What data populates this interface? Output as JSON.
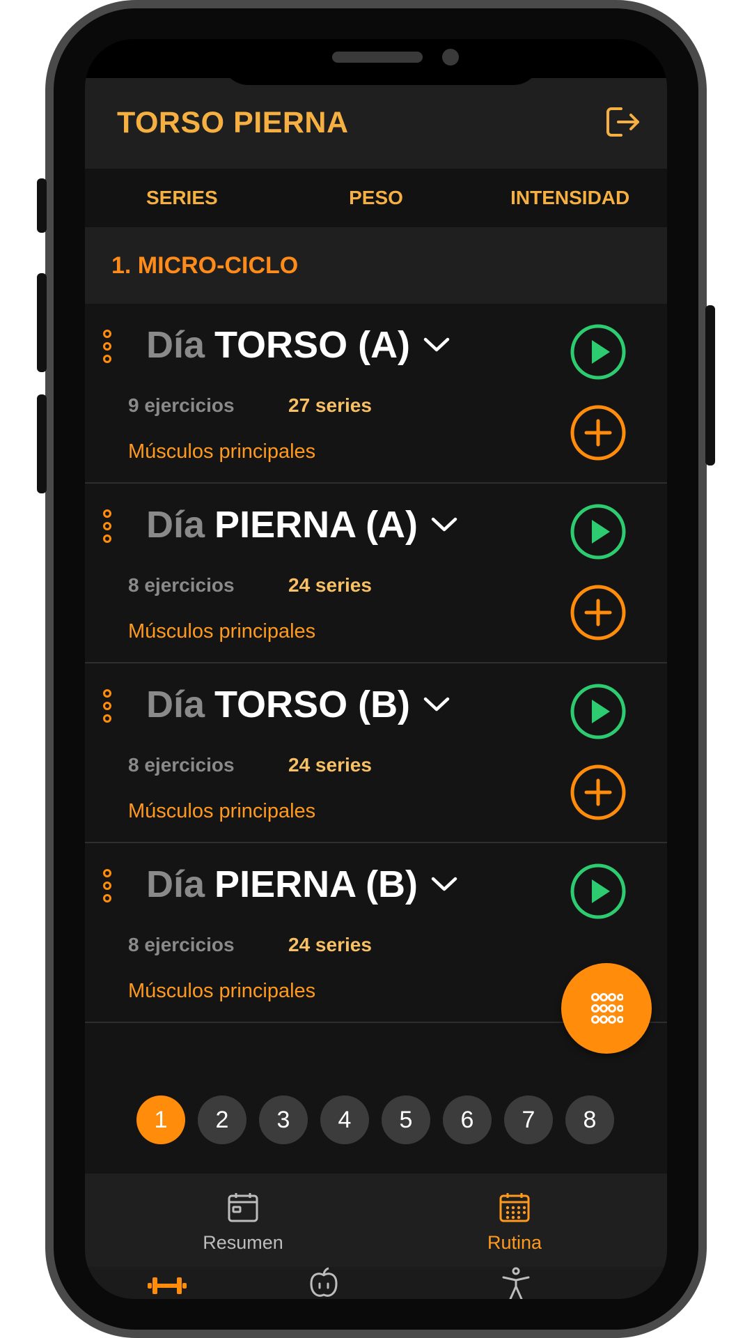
{
  "header": {
    "title": "TORSO PIERNA",
    "logout_icon": "logout-icon"
  },
  "tabs": [
    {
      "label": "SERIES"
    },
    {
      "label": "PESO"
    },
    {
      "label": "INTENSIDAD"
    }
  ],
  "cycle": {
    "title": "1. MICRO-CICLO"
  },
  "days": [
    {
      "prefix": "Día",
      "name": "TORSO (A)",
      "exercises": "9 ejercicios",
      "series": "27 series",
      "muscles": "Músculos principales"
    },
    {
      "prefix": "Día",
      "name": "PIERNA (A)",
      "exercises": "8 ejercicios",
      "series": "24 series",
      "muscles": "Músculos principales"
    },
    {
      "prefix": "Día",
      "name": "TORSO (B)",
      "exercises": "8 ejercicios",
      "series": "24 series",
      "muscles": "Músculos principales"
    },
    {
      "prefix": "Día",
      "name": "PIERNA (B)",
      "exercises": "8 ejercicios",
      "series": "24 series",
      "muscles": "Músculos principales"
    }
  ],
  "pager": {
    "pages": [
      "1",
      "2",
      "3",
      "4",
      "5",
      "6",
      "7",
      "8"
    ],
    "active": "1"
  },
  "subnav": {
    "items": [
      {
        "label": "Resumen",
        "icon": "calendar-icon",
        "active": false
      },
      {
        "label": "Rutina",
        "icon": "calendar-grid-icon",
        "active": true
      }
    ]
  },
  "bottomnav": {
    "items": [
      {
        "icon": "dumbbell-icon",
        "active": true
      },
      {
        "icon": "apple-icon",
        "active": false
      },
      {
        "icon": "accessibility-icon",
        "active": false
      }
    ]
  },
  "colors": {
    "accent": "#ff8c0a",
    "title": "#f6b042",
    "play": "#2ecc71",
    "background": "#141414"
  }
}
